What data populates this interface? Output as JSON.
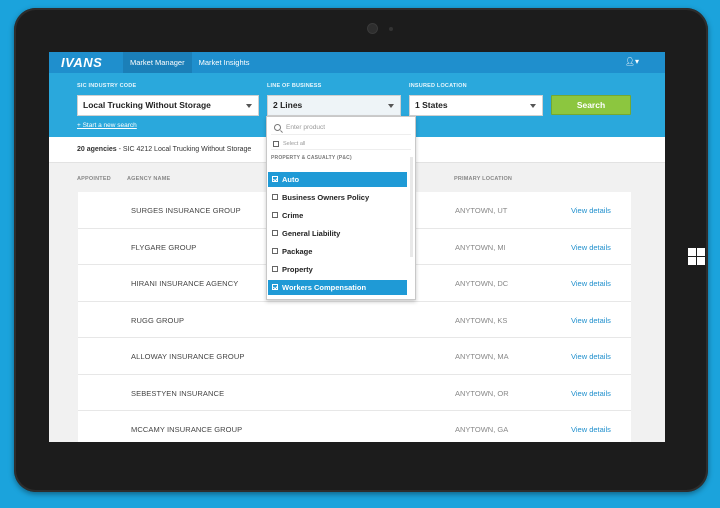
{
  "nav": {
    "logo": "IVANS",
    "tabs": [
      {
        "label": "Market Manager",
        "active": true
      },
      {
        "label": "Market Insights",
        "active": false
      }
    ],
    "user_icon": "user-icon"
  },
  "filters": {
    "sic_label": "SIC INDUSTRY CODE",
    "sic_value": "Local Trucking Without Storage",
    "lob_label": "LINE OF BUSINESS",
    "lob_value": "2 Lines",
    "location_label": "INSURED LOCATION",
    "location_value": "1 States",
    "search_label": "Search",
    "new_search": "+ Start a new search"
  },
  "dropdown": {
    "search_placeholder": "Enter product",
    "select_all": "Select all",
    "group": "PROPERTY & CASUALTY (P&C)",
    "items": [
      {
        "label": "Auto",
        "checked": true
      },
      {
        "label": "Business Owners Policy",
        "checked": false
      },
      {
        "label": "Crime",
        "checked": false
      },
      {
        "label": "General Liability",
        "checked": false
      },
      {
        "label": "Package",
        "checked": false
      },
      {
        "label": "Property",
        "checked": false
      },
      {
        "label": "Workers Compensation",
        "checked": true
      }
    ]
  },
  "summary": {
    "count": "20 agencies",
    "detail": " - SIC 4212 Local Trucking Without Storage"
  },
  "table": {
    "headers": {
      "appointed": "APPOINTED",
      "agency": "AGENCY NAME",
      "location": "PRIMARY LOCATION"
    },
    "rows": [
      {
        "name": "Surges Insurance Group",
        "location": "Anytown, UT",
        "action": "View details"
      },
      {
        "name": "Flygare Group",
        "location": "Anytown, MI",
        "action": "View details"
      },
      {
        "name": "Hirani Insurance Agency",
        "location": "Anytown, DC",
        "action": "View details"
      },
      {
        "name": "Rugg Group",
        "location": "Anytown, KS",
        "action": "View details"
      },
      {
        "name": "Alloway Insurance Group",
        "location": "Anytown, MA",
        "action": "View details"
      },
      {
        "name": "Sebestyen Insurance",
        "location": "Anytown, OR",
        "action": "View details"
      },
      {
        "name": "McCamy Insurance Group",
        "location": "Anytown, GA",
        "action": "View details"
      }
    ]
  },
  "colors": {
    "brand": "#1f8fcd",
    "search_button": "#8cc63f",
    "checked": "#1f9ad6"
  }
}
